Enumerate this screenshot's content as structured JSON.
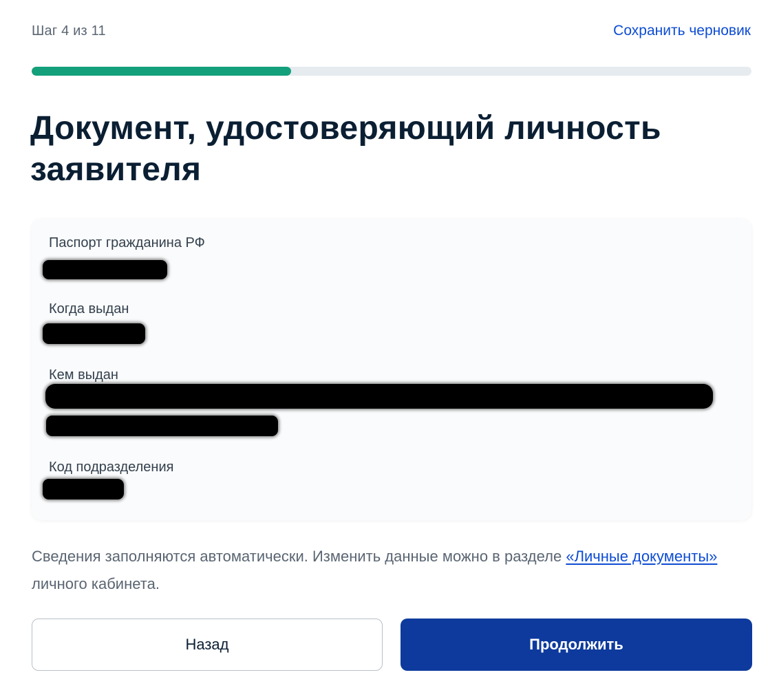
{
  "header": {
    "step_text": "Шаг 4 из 11",
    "save_draft_label": "Сохранить черновик"
  },
  "progress": {
    "value": 0.36,
    "fill_color": "#13a07b",
    "track_color": "#e6ebef"
  },
  "page": {
    "title": "Документ, удостоверяющий личность заявителя"
  },
  "document_card": {
    "fields": [
      {
        "label": "Паспорт гражданина РФ"
      },
      {
        "label": "Когда выдан"
      },
      {
        "label": "Кем выдан"
      },
      {
        "label": "Код подразделения"
      }
    ]
  },
  "hint": {
    "text_before": "Сведения заполняются автоматически. Изменить данные можно в разделе ",
    "link_label": "«Личные документы»",
    "text_after": " личного кабинета."
  },
  "actions": {
    "back_label": "Назад",
    "continue_label": "Продолжить",
    "primary_color": "#0d3a9c",
    "link_color": "#0d4cd3"
  }
}
